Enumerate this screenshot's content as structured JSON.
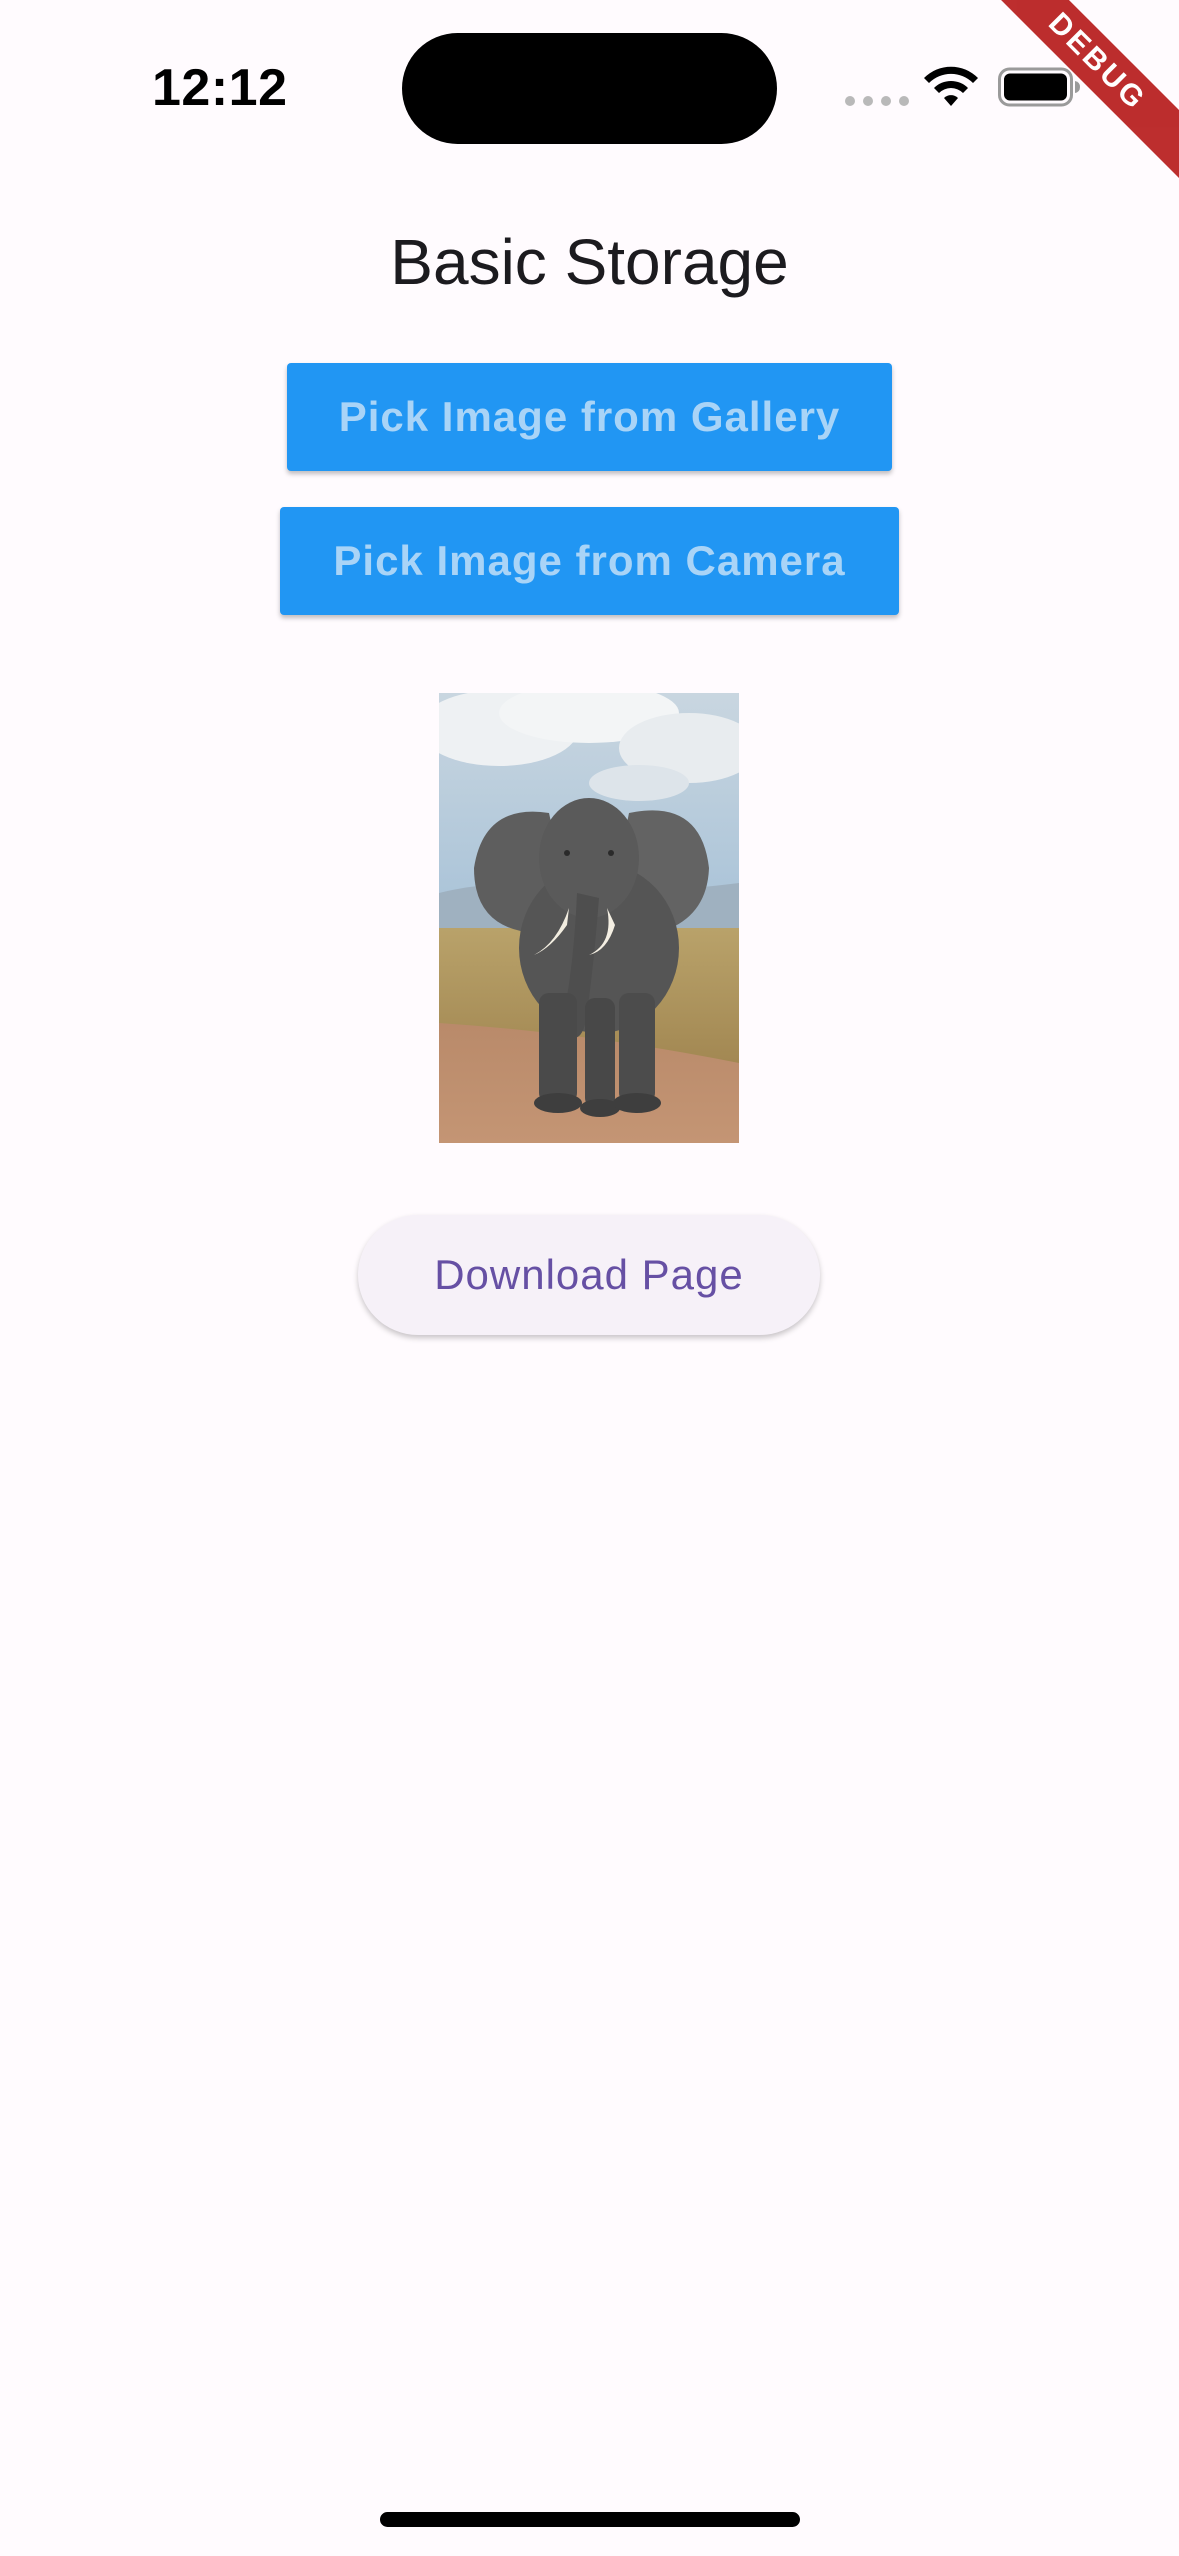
{
  "status_bar": {
    "time": "12:12",
    "icons": [
      "cellular-signal-icon",
      "wifi-icon",
      "battery-icon"
    ]
  },
  "debug_banner": {
    "label": "DEBUG",
    "color": "#b71c1c"
  },
  "page": {
    "title": "Basic Storage"
  },
  "actions": {
    "gallery_label": "Pick Image from Gallery",
    "camera_label": "Pick Image from Camera",
    "download_label": "Download Page"
  },
  "image": {
    "subject": "elephant-photo"
  },
  "colors": {
    "primary_button": "#2196f3",
    "primary_button_text": "#a9d4f7",
    "download_text": "#6650a4",
    "background": "#fffbfe"
  }
}
